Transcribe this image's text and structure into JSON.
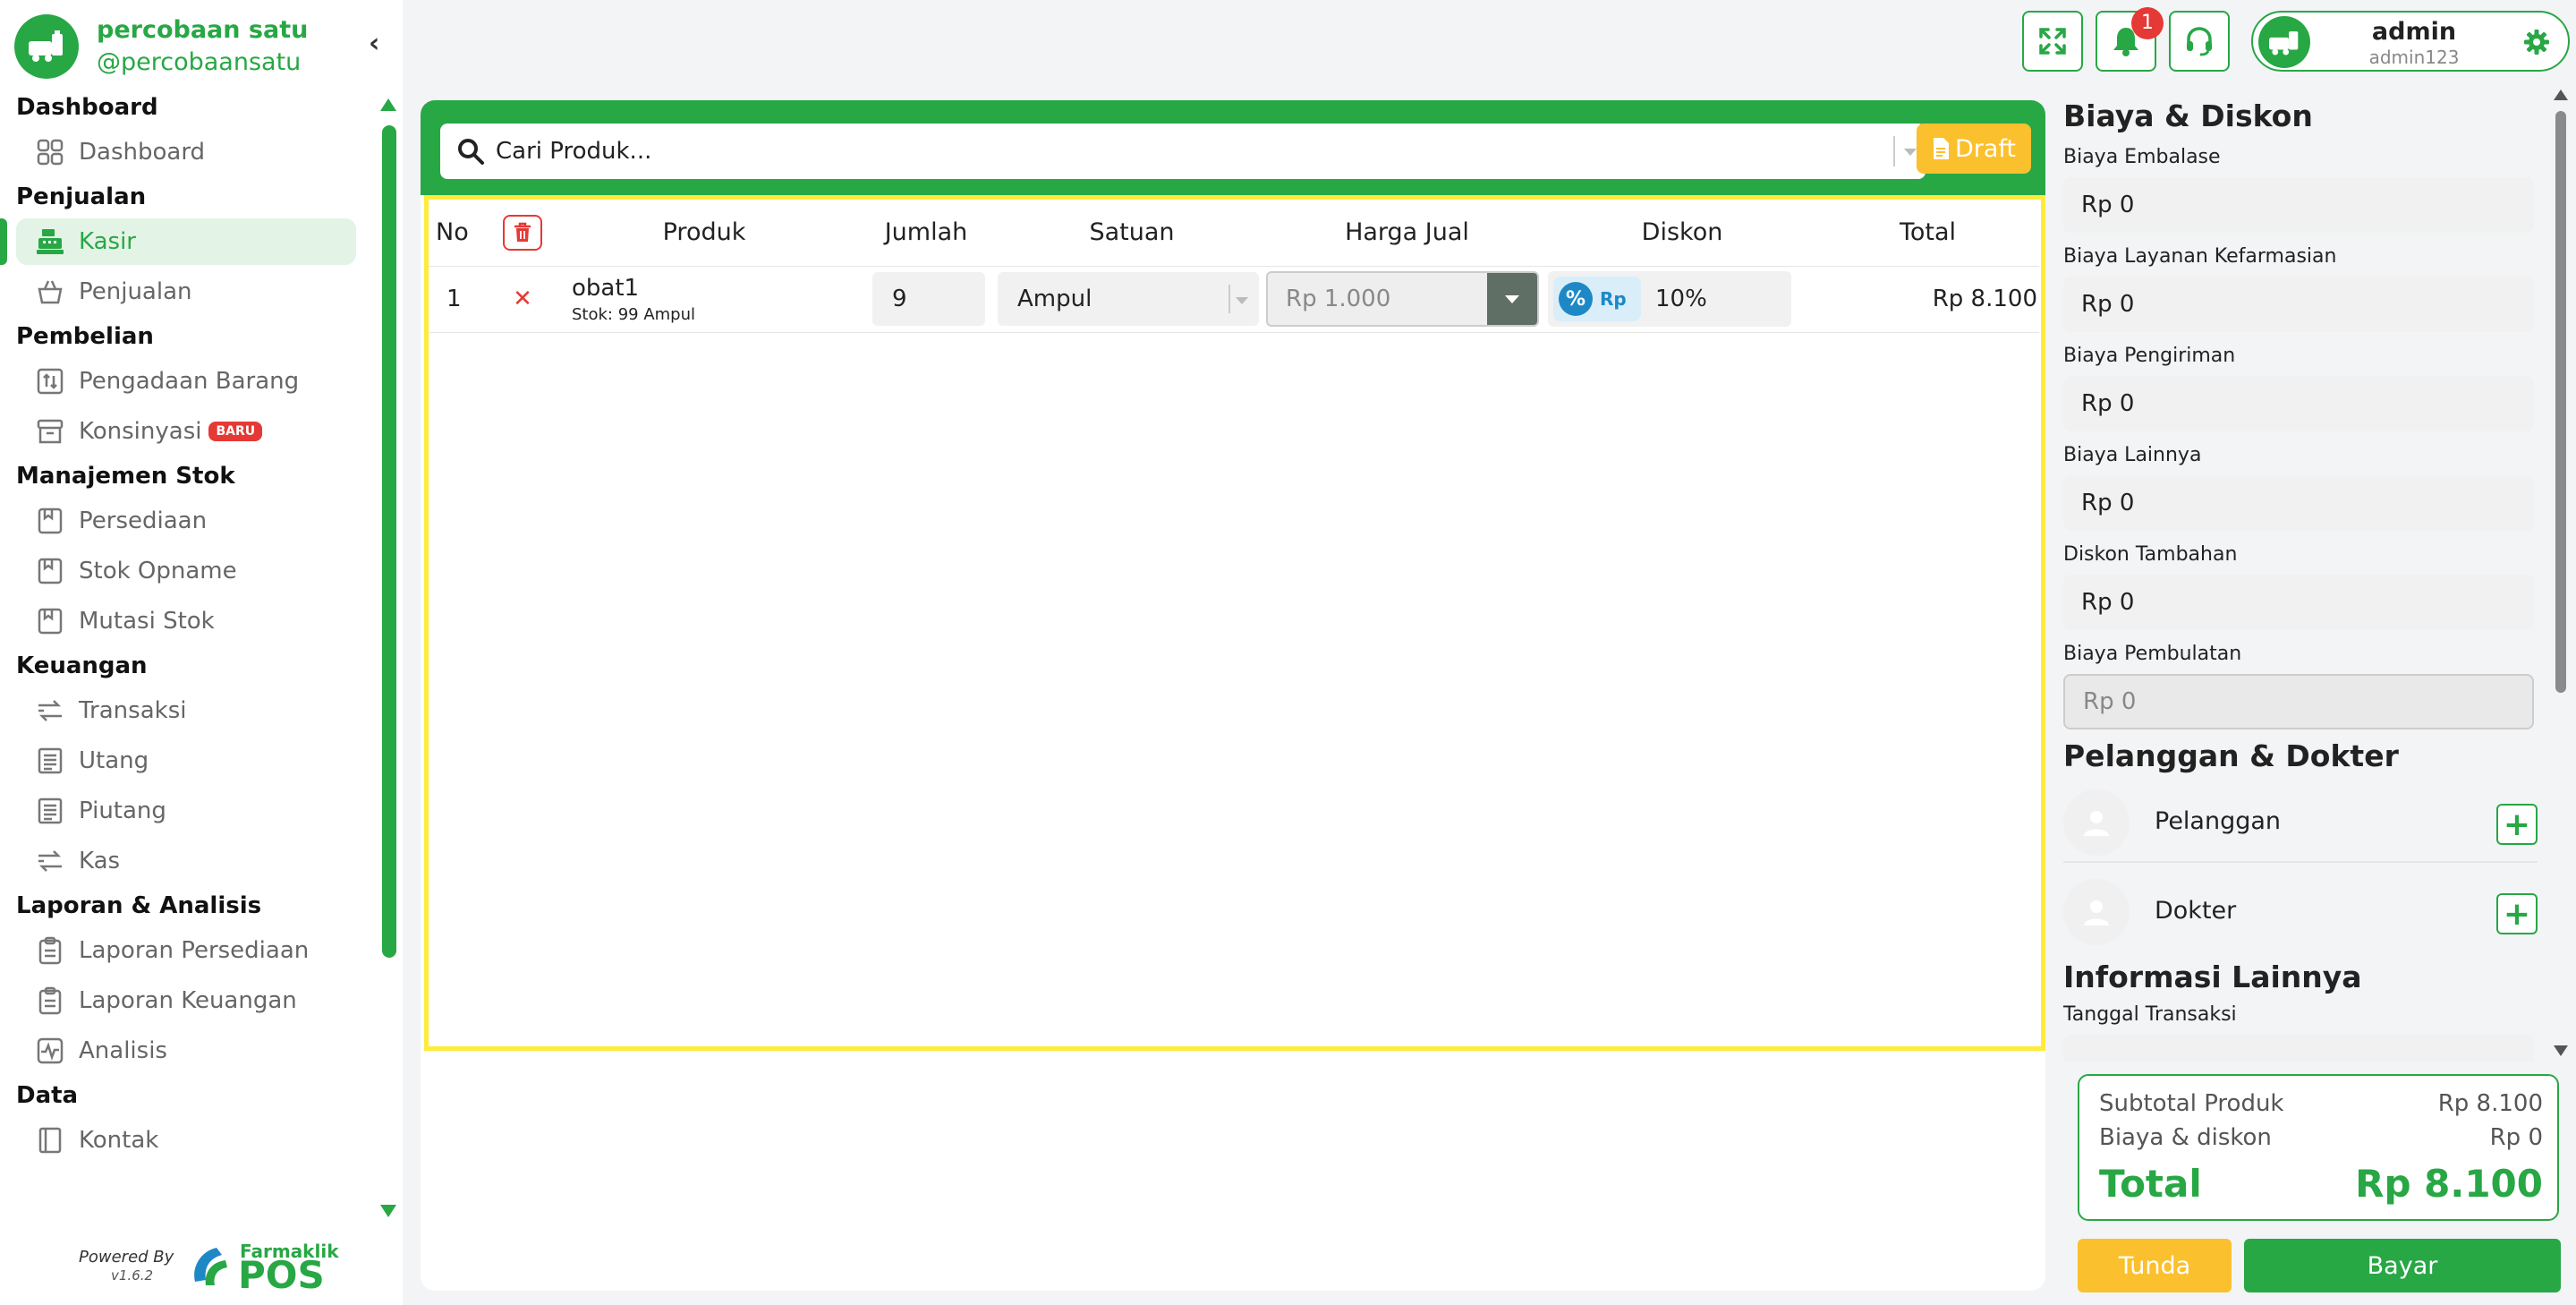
{
  "brand": {
    "name": "percobaan satu",
    "handle": "@percobaansatu"
  },
  "sidebar": {
    "sections": [
      {
        "title": "Dashboard",
        "items": [
          {
            "label": "Dashboard",
            "icon": "grid-icon",
            "active": false
          }
        ]
      },
      {
        "title": "Penjualan",
        "items": [
          {
            "label": "Kasir",
            "icon": "cash-register-icon",
            "active": true
          },
          {
            "label": "Penjualan",
            "icon": "basket-icon",
            "active": false
          }
        ]
      },
      {
        "title": "Pembelian",
        "items": [
          {
            "label": "Pengadaan Barang",
            "icon": "procurement-icon",
            "active": false
          },
          {
            "label": "Konsinyasi",
            "icon": "archive-box-icon",
            "active": false,
            "badge": "BARU"
          }
        ]
      },
      {
        "title": "Manajemen Stok",
        "items": [
          {
            "label": "Persediaan",
            "icon": "inventory-icon",
            "active": false
          },
          {
            "label": "Stok Opname",
            "icon": "inventory-icon",
            "active": false
          },
          {
            "label": "Mutasi Stok",
            "icon": "inventory-icon",
            "active": false
          }
        ]
      },
      {
        "title": "Keuangan",
        "items": [
          {
            "label": "Transaksi",
            "icon": "transfer-icon",
            "active": false
          },
          {
            "label": "Utang",
            "icon": "ledger-icon",
            "active": false
          },
          {
            "label": "Piutang",
            "icon": "ledger-icon",
            "active": false
          },
          {
            "label": "Kas",
            "icon": "transfer-icon",
            "active": false
          }
        ]
      },
      {
        "title": "Laporan & Analisis",
        "items": [
          {
            "label": "Laporan Persediaan",
            "icon": "clipboard-icon",
            "active": false
          },
          {
            "label": "Laporan Keuangan",
            "icon": "clipboard-icon",
            "active": false
          },
          {
            "label": "Analisis",
            "icon": "pulse-chart-icon",
            "active": false
          }
        ]
      },
      {
        "title": "Data",
        "items": [
          {
            "label": "Kontak",
            "icon": "contact-book-icon",
            "active": false
          }
        ]
      }
    ],
    "powered_by": "Powered By",
    "version": "v1.6.2",
    "partner_name": "Farmaklik",
    "partner_product": "POS"
  },
  "topbar": {
    "notification_count": "1",
    "user_name": "admin",
    "user_id": "admin123"
  },
  "search": {
    "placeholder": "Cari Produk..."
  },
  "draft_label": "Draft",
  "cart": {
    "headers": {
      "no": "No",
      "produk": "Produk",
      "jumlah": "Jumlah",
      "satuan": "Satuan",
      "harga_jual": "Harga Jual",
      "diskon": "Diskon",
      "total": "Total"
    },
    "rows": [
      {
        "no": "1",
        "product": "obat1",
        "stock": "Stok: 99 Ampul",
        "qty": "9",
        "unit": "Ampul",
        "price": "Rp 1.000",
        "discount_type_pct": "%",
        "discount_type_rp": "Rp",
        "discount": "10%",
        "total": "Rp 8.100"
      }
    ]
  },
  "fees": {
    "title": "Biaya & Diskon",
    "items": [
      {
        "label": "Biaya Embalase",
        "value": "Rp 0",
        "disabled": false
      },
      {
        "label": "Biaya Layanan Kefarmasian",
        "value": "Rp 0",
        "disabled": false
      },
      {
        "label": "Biaya Pengiriman",
        "value": "Rp 0",
        "disabled": false
      },
      {
        "label": "Biaya Lainnya",
        "value": "Rp 0",
        "disabled": false
      },
      {
        "label": "Diskon Tambahan",
        "value": "Rp 0",
        "disabled": false
      },
      {
        "label": "Biaya Pembulatan",
        "value": "Rp 0",
        "disabled": true
      }
    ]
  },
  "customer_doctor": {
    "title": "Pelanggan & Dokter",
    "customer": "Pelanggan",
    "doctor": "Dokter"
  },
  "other_info": {
    "title": "Informasi Lainnya",
    "date_label": "Tanggal Transaksi"
  },
  "summary": {
    "subtotal_label": "Subtotal Produk",
    "subtotal_value": "Rp 8.100",
    "fees_label": "Biaya & diskon",
    "fees_value": "Rp 0",
    "total_label": "Total",
    "total_value": "Rp 8.100"
  },
  "actions": {
    "hold": "Tunda",
    "pay": "Bayar"
  },
  "colors": {
    "brand_green": "#28a745",
    "accent_yellow": "#fbc02d",
    "danger_red": "#e53935",
    "highlight_border": "#ffeb3b"
  }
}
